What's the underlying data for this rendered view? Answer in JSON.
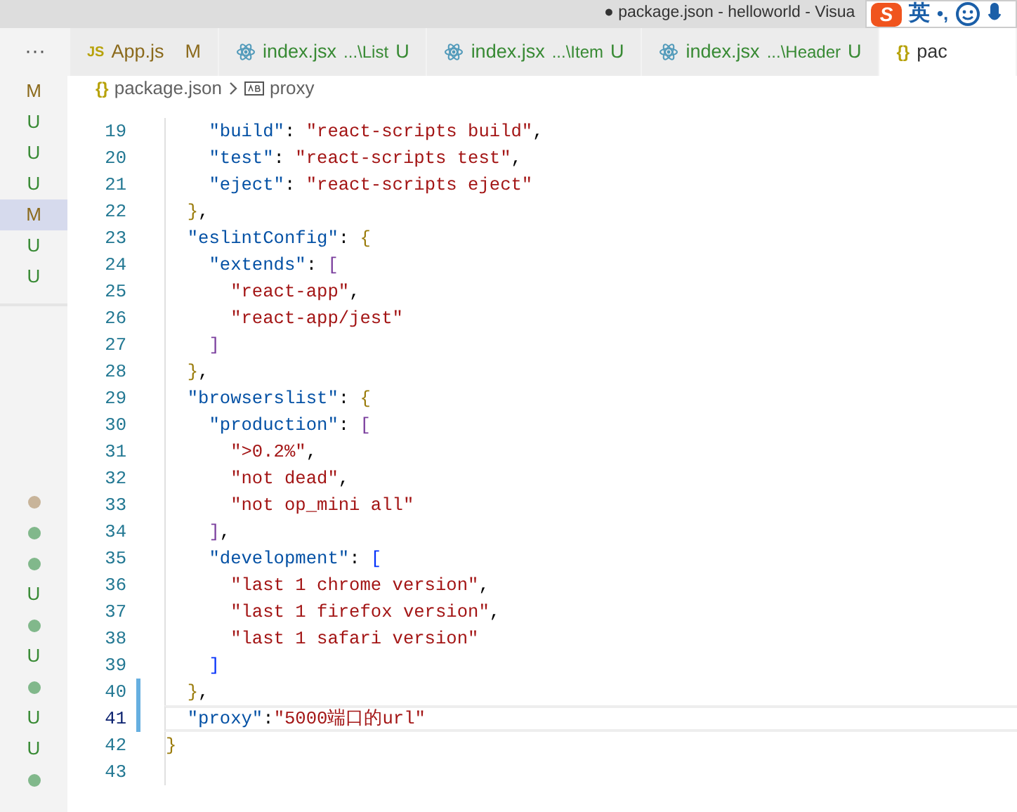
{
  "window": {
    "title": "● package.json - helloworld - Visua"
  },
  "ime_bar": {
    "logo": "S",
    "mode": "英",
    "punctuation": "•,"
  },
  "tabs_overflow": "···",
  "tabs": [
    {
      "kind": "js",
      "icon_text": "JS",
      "label": "App.js",
      "status": "M",
      "color": "#8b6a1c",
      "selected": false
    },
    {
      "kind": "react",
      "label": "index.jsx",
      "description": "...\\List",
      "status": "U",
      "color": "#388a34",
      "selected": false
    },
    {
      "kind": "react",
      "label": "index.jsx",
      "description": "...\\Item",
      "status": "U",
      "color": "#388a34",
      "selected": false
    },
    {
      "kind": "react",
      "label": "index.jsx",
      "description": "...\\Header",
      "status": "U",
      "color": "#388a34",
      "selected": false
    },
    {
      "kind": "json",
      "icon_text": "{}",
      "label": "pac",
      "color": "#333333",
      "selected": true
    }
  ],
  "breadcrumb": [
    {
      "kind": "file",
      "icon_text": "{}",
      "label": "package.json"
    },
    {
      "kind": "property",
      "label": "proxy"
    }
  ],
  "sidebar": {
    "top": [
      {
        "text": "M",
        "color": "#8b6a1c",
        "selected": false
      },
      {
        "text": "U",
        "color": "#388a34",
        "selected": false
      },
      {
        "text": "U",
        "color": "#388a34",
        "selected": false
      },
      {
        "text": "U",
        "color": "#388a34",
        "selected": false
      },
      {
        "text": "M",
        "color": "#8b6a1c",
        "selected": true
      },
      {
        "text": "U",
        "color": "#388a34",
        "selected": false
      },
      {
        "text": "U",
        "color": "#388a34",
        "selected": false
      }
    ],
    "bottom": [
      {
        "kind": "dot",
        "color": "#c8b49a"
      },
      {
        "kind": "dot",
        "color": "#81b88b"
      },
      {
        "kind": "dot",
        "color": "#81b88b"
      },
      {
        "kind": "letter",
        "text": "U",
        "color": "#388a34"
      },
      {
        "kind": "dot",
        "color": "#81b88b"
      },
      {
        "kind": "letter",
        "text": "U",
        "color": "#388a34"
      },
      {
        "kind": "dot",
        "color": "#81b88b"
      },
      {
        "kind": "letter",
        "text": "U",
        "color": "#388a34"
      },
      {
        "kind": "letter",
        "text": "U",
        "color": "#388a34"
      },
      {
        "kind": "dot",
        "color": "#81b88b"
      }
    ]
  },
  "editor": {
    "lines": [
      {
        "number": "19",
        "modified": false,
        "current": false,
        "tokens": [
          {
            "kind": "key",
            "text": "    \"build\""
          },
          {
            "kind": "p",
            "text": ": "
          },
          {
            "kind": "str",
            "text": "\"react-scripts build\""
          },
          {
            "kind": "p",
            "text": ","
          }
        ]
      },
      {
        "number": "20",
        "modified": false,
        "current": false,
        "tokens": [
          {
            "kind": "key",
            "text": "    \"test\""
          },
          {
            "kind": "p",
            "text": ": "
          },
          {
            "kind": "str",
            "text": "\"react-scripts test\""
          },
          {
            "kind": "p",
            "text": ","
          }
        ]
      },
      {
        "number": "21",
        "modified": false,
        "current": false,
        "tokens": [
          {
            "kind": "key",
            "text": "    \"eject\""
          },
          {
            "kind": "p",
            "text": ": "
          },
          {
            "kind": "str",
            "text": "\"react-scripts eject\""
          }
        ]
      },
      {
        "number": "22",
        "modified": false,
        "current": false,
        "tokens": [
          {
            "kind": "b1",
            "text": "  }"
          },
          {
            "kind": "p",
            "text": ","
          }
        ]
      },
      {
        "number": "23",
        "modified": false,
        "current": false,
        "tokens": [
          {
            "kind": "key",
            "text": "  \"eslintConfig\""
          },
          {
            "kind": "p",
            "text": ": "
          },
          {
            "kind": "b1",
            "text": "{"
          }
        ]
      },
      {
        "number": "24",
        "modified": false,
        "current": false,
        "tokens": [
          {
            "kind": "key",
            "text": "    \"extends\""
          },
          {
            "kind": "p",
            "text": ": "
          },
          {
            "kind": "b2",
            "text": "["
          }
        ]
      },
      {
        "number": "25",
        "modified": false,
        "current": false,
        "tokens": [
          {
            "kind": "str",
            "text": "      \"react-app\""
          },
          {
            "kind": "p",
            "text": ","
          }
        ]
      },
      {
        "number": "26",
        "modified": false,
        "current": false,
        "tokens": [
          {
            "kind": "str",
            "text": "      \"react-app/jest\""
          }
        ]
      },
      {
        "number": "27",
        "modified": false,
        "current": false,
        "tokens": [
          {
            "kind": "b2",
            "text": "    ]"
          }
        ]
      },
      {
        "number": "28",
        "modified": false,
        "current": false,
        "tokens": [
          {
            "kind": "b1",
            "text": "  }"
          },
          {
            "kind": "p",
            "text": ","
          }
        ]
      },
      {
        "number": "29",
        "modified": false,
        "current": false,
        "tokens": [
          {
            "kind": "key",
            "text": "  \"browserslist\""
          },
          {
            "kind": "p",
            "text": ": "
          },
          {
            "kind": "b1",
            "text": "{"
          }
        ]
      },
      {
        "number": "30",
        "modified": false,
        "current": false,
        "tokens": [
          {
            "kind": "key",
            "text": "    \"production\""
          },
          {
            "kind": "p",
            "text": ": "
          },
          {
            "kind": "b2",
            "text": "["
          }
        ]
      },
      {
        "number": "31",
        "modified": false,
        "current": false,
        "tokens": [
          {
            "kind": "str",
            "text": "      \">0.2%\""
          },
          {
            "kind": "p",
            "text": ","
          }
        ]
      },
      {
        "number": "32",
        "modified": false,
        "current": false,
        "tokens": [
          {
            "kind": "str",
            "text": "      \"not dead\""
          },
          {
            "kind": "p",
            "text": ","
          }
        ]
      },
      {
        "number": "33",
        "modified": false,
        "current": false,
        "tokens": [
          {
            "kind": "str",
            "text": "      \"not op_mini all\""
          }
        ]
      },
      {
        "number": "34",
        "modified": false,
        "current": false,
        "tokens": [
          {
            "kind": "b2",
            "text": "    ]"
          },
          {
            "kind": "p",
            "text": ","
          }
        ]
      },
      {
        "number": "35",
        "modified": false,
        "current": false,
        "tokens": [
          {
            "kind": "key",
            "text": "    \"development\""
          },
          {
            "kind": "p",
            "text": ": "
          },
          {
            "kind": "b3",
            "text": "["
          }
        ]
      },
      {
        "number": "36",
        "modified": false,
        "current": false,
        "tokens": [
          {
            "kind": "str",
            "text": "      \"last 1 chrome version\""
          },
          {
            "kind": "p",
            "text": ","
          }
        ]
      },
      {
        "number": "37",
        "modified": false,
        "current": false,
        "tokens": [
          {
            "kind": "str",
            "text": "      \"last 1 firefox version\""
          },
          {
            "kind": "p",
            "text": ","
          }
        ]
      },
      {
        "number": "38",
        "modified": false,
        "current": false,
        "tokens": [
          {
            "kind": "str",
            "text": "      \"last 1 safari version\""
          }
        ]
      },
      {
        "number": "39",
        "modified": false,
        "current": false,
        "tokens": [
          {
            "kind": "b3",
            "text": "    ]"
          }
        ]
      },
      {
        "number": "40",
        "modified": true,
        "current": false,
        "tokens": [
          {
            "kind": "b1",
            "text": "  }"
          },
          {
            "kind": "p",
            "text": ","
          }
        ]
      },
      {
        "number": "41",
        "modified": true,
        "current": true,
        "tokens": [
          {
            "kind": "key",
            "text": "  \"proxy\""
          },
          {
            "kind": "p",
            "text": ":"
          },
          {
            "kind": "str",
            "text": "\"5000端口的url\""
          }
        ]
      },
      {
        "number": "42",
        "modified": false,
        "current": false,
        "tokens": [
          {
            "kind": "b1",
            "text": "}"
          }
        ]
      },
      {
        "number": "43",
        "modified": false,
        "current": false
      }
    ]
  }
}
